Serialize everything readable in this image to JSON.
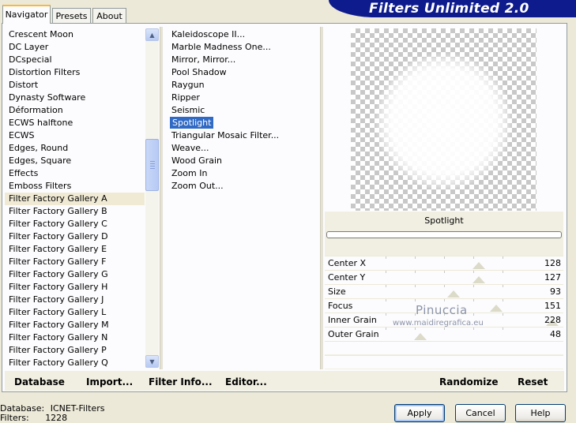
{
  "tabs": [
    {
      "label": "Navigator",
      "active": true
    },
    {
      "label": "Presets",
      "active": false
    },
    {
      "label": "About",
      "active": false
    }
  ],
  "app_title": "Filters Unlimited 2.0",
  "categories": [
    "Crescent Moon",
    "DC Layer",
    "DCspecial",
    "Distortion Filters",
    "Distort",
    "Dynasty Software",
    "Déformation",
    "ECWS halftone",
    "ECWS",
    "Edges, Round",
    "Edges, Square",
    "Effects",
    "Emboss Filters",
    "Filter Factory Gallery A",
    "Filter Factory Gallery B",
    "Filter Factory Gallery C",
    "Filter Factory Gallery D",
    "Filter Factory Gallery E",
    "Filter Factory Gallery F",
    "Filter Factory Gallery G",
    "Filter Factory Gallery H",
    "Filter Factory Gallery J",
    "Filter Factory Gallery L",
    "Filter Factory Gallery M",
    "Filter Factory Gallery N",
    "Filter Factory Gallery P",
    "Filter Factory Gallery Q"
  ],
  "selected_category": "Filter Factory Gallery A",
  "filters": [
    "Kaleidoscope II...",
    "Marble Madness One...",
    "Mirror, Mirror...",
    "Pool Shadow",
    "Raygun",
    "Ripper",
    "Seismic",
    "Spotlight",
    "Triangular Mosaic Filter...",
    "Weave...",
    "Wood Grain",
    "Zoom In",
    "Zoom Out..."
  ],
  "selected_filter": "Spotlight",
  "filter_name": "Spotlight",
  "sliders": [
    {
      "label": "Center X",
      "value": 128
    },
    {
      "label": "Center Y",
      "value": 127
    },
    {
      "label": "Size",
      "value": 93
    },
    {
      "label": "Focus",
      "value": 151
    },
    {
      "label": "Inner Grain",
      "value": 228
    },
    {
      "label": "Outer Grain",
      "value": 48
    }
  ],
  "slider_max": 255,
  "watermark": {
    "line1": "Pinuccia",
    "line2": "www.maidiregrafica.eu"
  },
  "toolbar": {
    "database": "Database",
    "import": "Import...",
    "filter_info": "Filter Info...",
    "editor": "Editor...",
    "randomize": "Randomize",
    "reset": "Reset"
  },
  "status": {
    "database_label": "Database:",
    "database_value": "ICNET-Filters",
    "filters_label": "Filters:",
    "filters_value": "1228"
  },
  "buttons": {
    "apply": "Apply",
    "cancel": "Cancel",
    "help": "Help"
  },
  "colors": {
    "banner": "#0e1b8c",
    "selection": "#316ac5",
    "accent_tab": "#f7b842"
  }
}
